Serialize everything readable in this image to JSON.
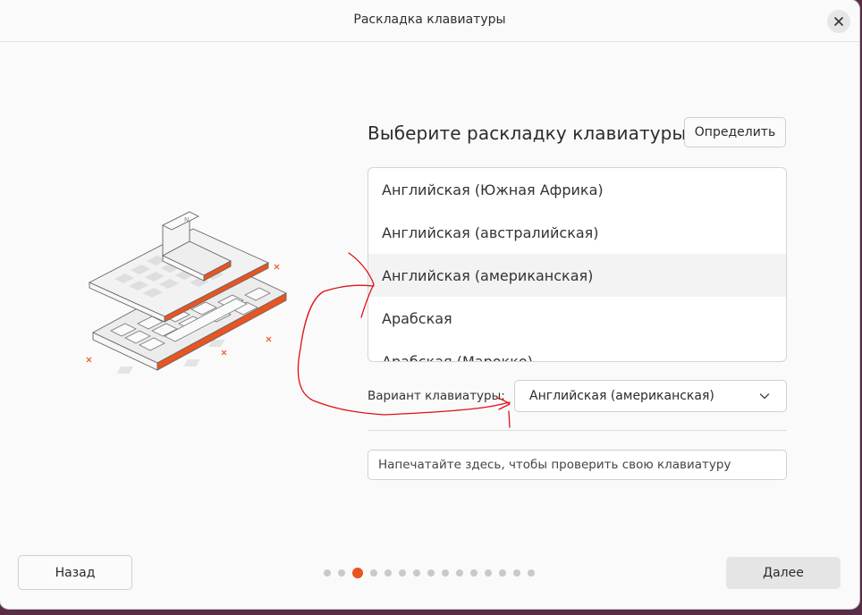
{
  "window": {
    "title": "Раскладка клавиатуры"
  },
  "heading": "Выберите раскладку клавиатуры",
  "detect_button": "Определить",
  "layouts": [
    {
      "label": "Английская (Южная Африка)",
      "selected": false
    },
    {
      "label": "Английская (австралийская)",
      "selected": false
    },
    {
      "label": "Английская (американская)",
      "selected": true
    },
    {
      "label": "Арабская",
      "selected": false
    },
    {
      "label": "Арабская (Марокко)",
      "selected": false
    }
  ],
  "variant": {
    "label": "Вариант клавиатуры:",
    "value": "Английская (американская)"
  },
  "test_input": {
    "placeholder": "Напечатайте здесь, чтобы проверить свою клавиатуру",
    "value": ""
  },
  "nav": {
    "back": "Назад",
    "next": "Далее",
    "steps_total": 15,
    "current_step": 3
  },
  "colors": {
    "accent": "#e95420",
    "annotation": "#e0101a"
  }
}
